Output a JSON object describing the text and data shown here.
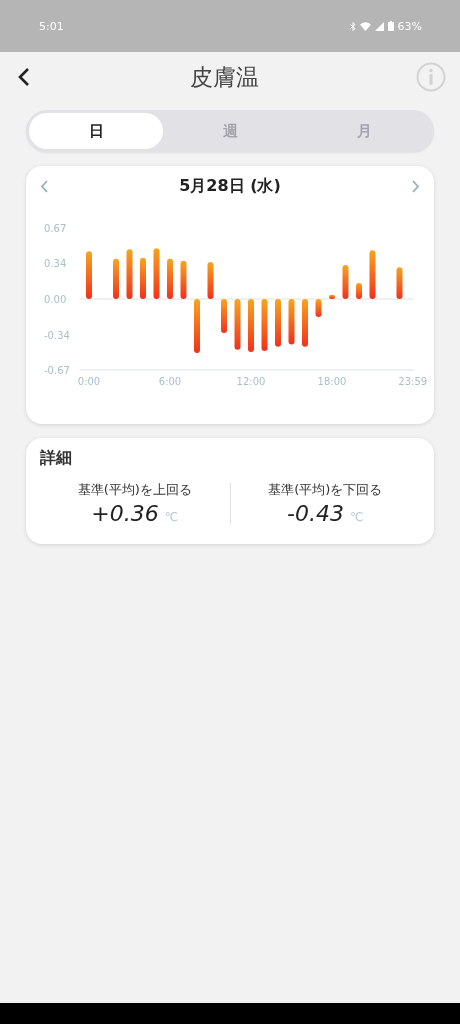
{
  "status_bar": {
    "time": "5:01",
    "battery": "63%"
  },
  "header": {
    "title": "皮膚温"
  },
  "tabs": [
    {
      "label": "日",
      "selected": true
    },
    {
      "label": "週",
      "selected": false
    },
    {
      "label": "月",
      "selected": false
    }
  ],
  "chart_card": {
    "date": "5月28日 (水)",
    "chart_data": {
      "type": "bar",
      "x": [
        0,
        1,
        2,
        3,
        4,
        5,
        6,
        7,
        8,
        9,
        10,
        11,
        12,
        13,
        14,
        15,
        16,
        17,
        18,
        19,
        20,
        21,
        22,
        23
      ],
      "values": [
        0.45,
        null,
        0.38,
        0.47,
        0.39,
        0.48,
        0.38,
        0.36,
        -0.51,
        0.35,
        -0.32,
        -0.48,
        -0.5,
        -0.49,
        -0.45,
        -0.43,
        -0.45,
        -0.17,
        0.04,
        0.32,
        0.15,
        0.46,
        null,
        0.3
      ],
      "xlim": [
        0,
        24
      ],
      "ylim": [
        -0.67,
        0.67
      ],
      "yticks": [
        0.67,
        0.34,
        {
          "value": 0,
          "label": "0.00"
        },
        -0.34,
        -0.67
      ],
      "xticks": [
        {
          "value": 0,
          "label": "0:00"
        },
        {
          "value": 6,
          "label": "6:00"
        },
        {
          "value": 12,
          "label": "12:00"
        },
        {
          "value": 18,
          "label": "18:00"
        },
        {
          "value": 23.98,
          "label": "23:59"
        }
      ]
    }
  },
  "details": {
    "title": "詳細",
    "items": [
      {
        "label": "基準(平均)を上回る",
        "value": "+0.36",
        "unit": "℃"
      },
      {
        "label": "基準(平均)を下回る",
        "value": "-0.43",
        "unit": "℃"
      }
    ]
  }
}
